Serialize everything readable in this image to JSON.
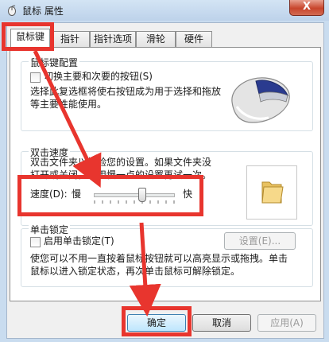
{
  "window": {
    "title": "鼠标 属性",
    "close_label": "X"
  },
  "tabs": [
    {
      "label": "鼠标键"
    },
    {
      "label": "指针"
    },
    {
      "label": "指针选项"
    },
    {
      "label": "滑轮"
    },
    {
      "label": "硬件"
    }
  ],
  "button_config": {
    "group_title": "鼠标键配置",
    "swap_checkbox_label": "切换主要和次要的按钮(S)",
    "swap_checked": false,
    "description_line1": "选择此复选框将使右按钮成为用于选择和拖放",
    "description_line2": "等主要性能使用。"
  },
  "double_click": {
    "group_title": "双击速度",
    "description_line1": "双击文件夹以检验您的设置。如果文件夹没",
    "description_line2": "打开或关闭，请用慢一点的设置再试一次。",
    "speed_label": "速度(D):",
    "slow_label": "慢",
    "fast_label": "快",
    "speed_level": 0.6
  },
  "click_lock": {
    "group_title": "单击锁定",
    "checkbox_label": "启用单击锁定(T)",
    "checked": false,
    "settings_button": "设置(E)...",
    "description_line1": "使您可以不用一直按着鼠标按钮就可以高亮显示或拖拽。单击",
    "description_line2": "鼠标以进入锁定状态，再次单击鼠标可解除锁定。"
  },
  "footer": {
    "ok": "确定",
    "cancel": "取消",
    "apply": "应用(A)"
  },
  "colors": {
    "highlight": "#e8352e",
    "accent": "#3a6ea5"
  }
}
